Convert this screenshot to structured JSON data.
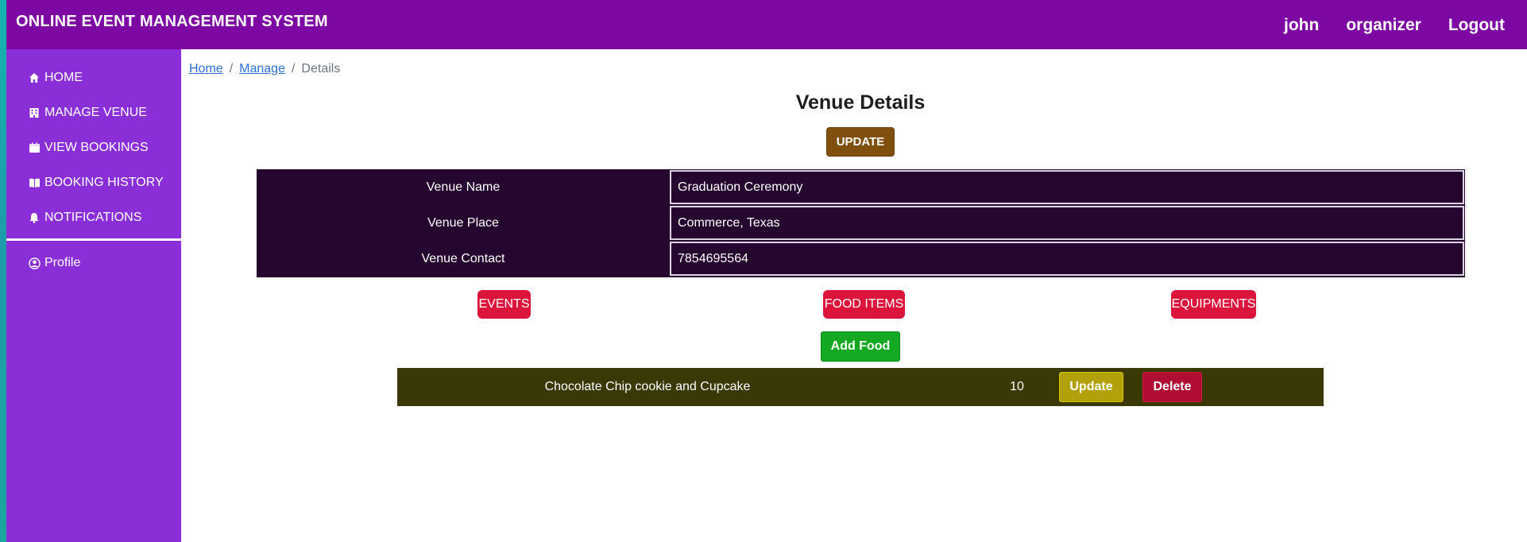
{
  "header": {
    "app_title": "ONLINE EVENT MANAGEMENT SYSTEM",
    "nav": [
      "john",
      "organizer",
      "Logout"
    ]
  },
  "sidebar": {
    "items": [
      {
        "label": "HOME",
        "icon": "home-icon"
      },
      {
        "label": "MANAGE VENUE",
        "icon": "venue-icon"
      },
      {
        "label": "VIEW BOOKINGS",
        "icon": "calendar-icon"
      },
      {
        "label": "BOOKING HISTORY",
        "icon": "book-icon"
      },
      {
        "label": "NOTIFICATIONS",
        "icon": "bell-icon"
      }
    ],
    "profile": {
      "label": "Profile",
      "icon": "user-circle-icon"
    }
  },
  "breadcrumb": {
    "home": "Home",
    "manage": "Manage",
    "current": "Details",
    "separator": "/"
  },
  "page": {
    "title": "Venue Details",
    "update_label": "UPDATE"
  },
  "venue": {
    "rows": [
      {
        "label": "Venue Name",
        "value": "Graduation  Ceremony"
      },
      {
        "label": "Venue Place",
        "value": "Commerce, Texas"
      },
      {
        "label": "Venue Contact",
        "value": "7854695564"
      }
    ]
  },
  "tabs": [
    "EVENTS",
    "FOOD ITEMS",
    "EQUIPMENTS"
  ],
  "food": {
    "add_label": "Add Food",
    "items": [
      {
        "name": "Chocolate Chip cookie and Cupcake",
        "quantity": "10",
        "update_label": "Update",
        "delete_label": "Delete"
      }
    ]
  },
  "colors": {
    "header": "#7d07a2",
    "sidebar": "#8a2fd8",
    "table": "#25062f",
    "tab": "#dc143c",
    "add": "#15a823",
    "food_row": "#3a3805",
    "row_update": "#b3a10b",
    "row_delete": "#b00d33",
    "update_button": "#7f4f0d"
  }
}
